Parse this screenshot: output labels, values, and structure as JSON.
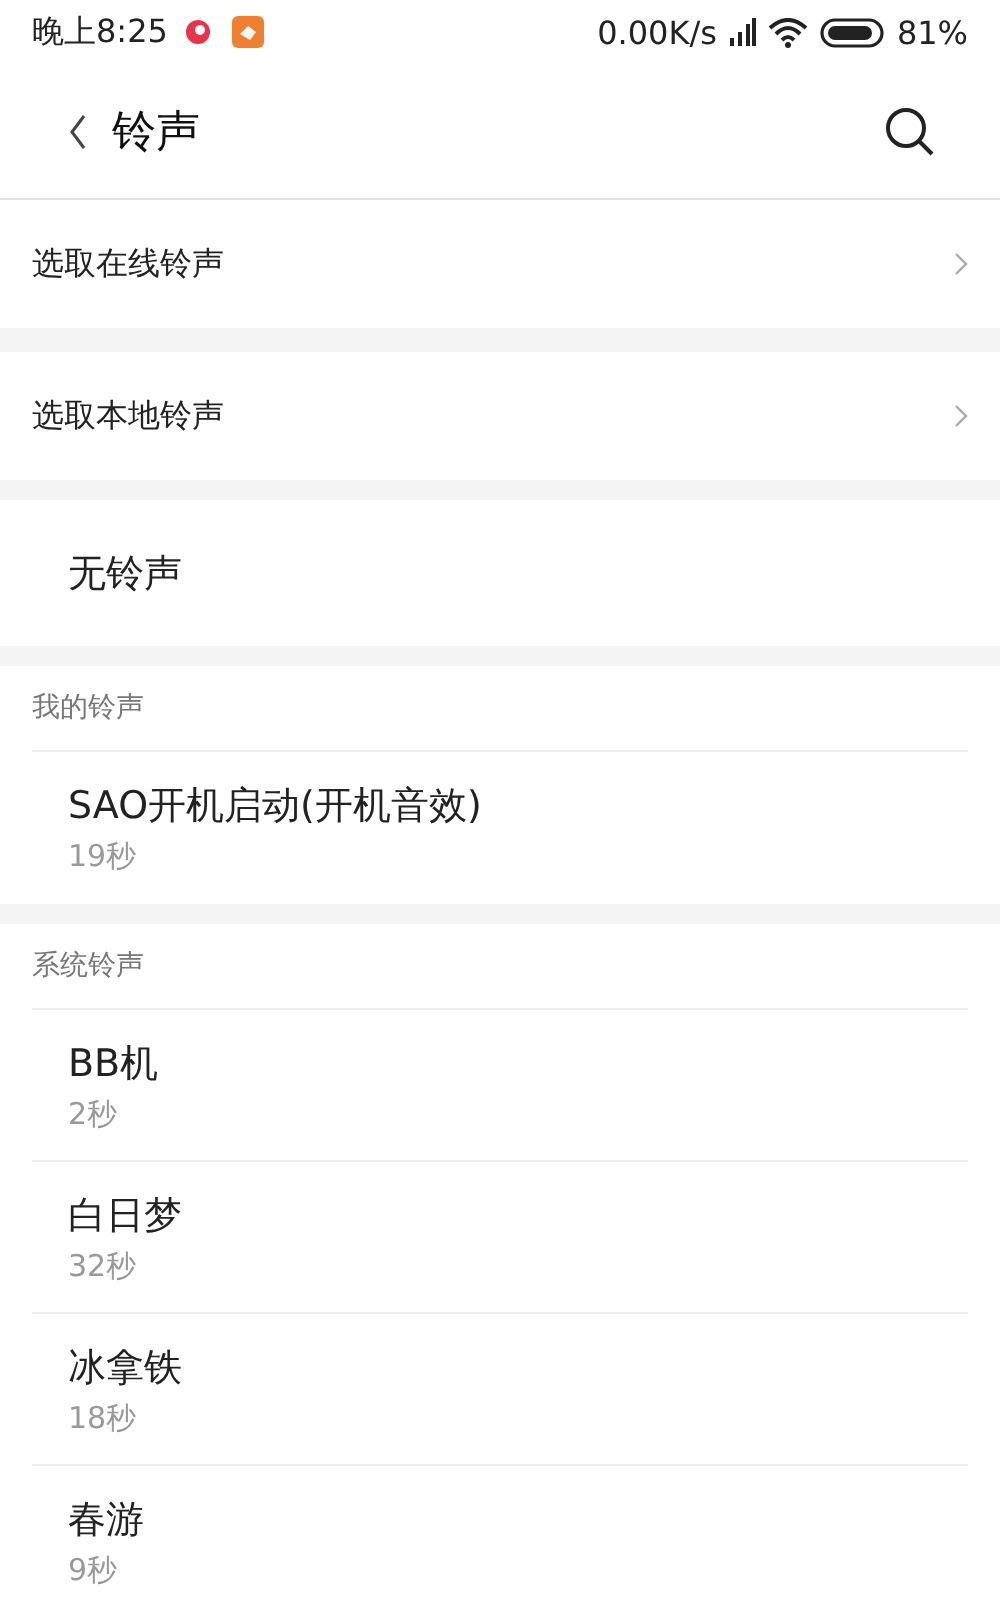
{
  "status_bar": {
    "time": "晚上8:25",
    "speed": "0.00K/s",
    "battery": "81%"
  },
  "header": {
    "title": "铃声"
  },
  "actions": [
    {
      "label": "选取在线铃声"
    },
    {
      "label": "选取本地铃声"
    }
  ],
  "none_option": {
    "label": "无铃声"
  },
  "sections": [
    {
      "title": "我的铃声",
      "items": [
        {
          "name": "SAO开机启动(开机音效)",
          "duration": "19秒"
        }
      ]
    },
    {
      "title": "系统铃声",
      "items": [
        {
          "name": "BB机",
          "duration": "2秒"
        },
        {
          "name": "白日梦",
          "duration": "32秒"
        },
        {
          "name": "冰拿铁",
          "duration": "18秒"
        },
        {
          "name": "春游",
          "duration": "9秒"
        }
      ]
    }
  ]
}
